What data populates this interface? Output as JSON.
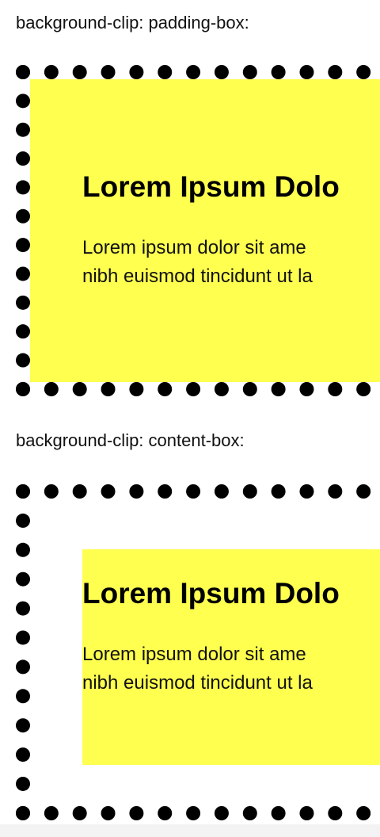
{
  "sections": [
    {
      "label": "background-clip: padding-box:",
      "title": "Lorem Ipsum Dolo",
      "text": "Lorem ipsum dolor sit ame\nnibh euismod tincidunt ut la"
    },
    {
      "label": "background-clip: content-box:",
      "title": "Lorem Ipsum Dolo",
      "text": "Lorem ipsum dolor sit ame\nnibh euismod tincidunt ut la"
    }
  ],
  "colors": {
    "background": "#ffffff",
    "box_fill": "#ffff50",
    "border": "#000000"
  }
}
